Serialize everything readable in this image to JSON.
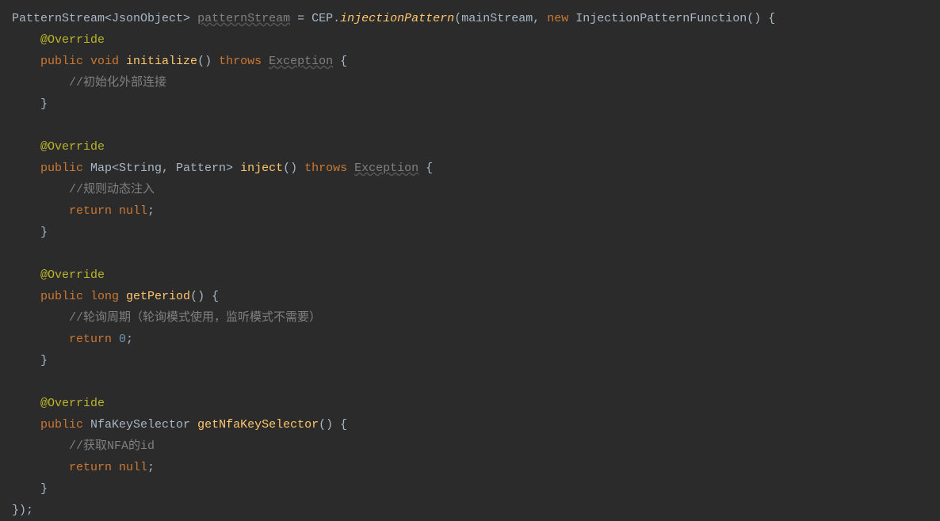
{
  "code": {
    "line1": {
      "type1": "PatternStream",
      "generic1": "<JsonObject>",
      "varName": "patternStream",
      "equals": " = ",
      "cls": "CEP",
      "dot": ".",
      "method": "injectionPattern",
      "args1": "(mainStream, ",
      "newKw": "new",
      "ctor": " InjectionPatternFunction() {"
    },
    "override1": "@Override",
    "line2": {
      "mods": "public void ",
      "method": "initialize",
      "parens": "() ",
      "throwsKw": "throws",
      "sp": " ",
      "exc": "Exception",
      "brace": " {"
    },
    "comment1": "//初始化外部连接",
    "closeBrace1": "}",
    "override2": "@Override",
    "line3": {
      "pub": "public ",
      "ret": "Map<String, Pattern> ",
      "method": "inject",
      "parens": "() ",
      "throwsKw": "throws",
      "sp": " ",
      "exc": "Exception",
      "brace": " {"
    },
    "comment2": "//规则动态注入",
    "return1": {
      "kw": "return ",
      "val": "null",
      "semi": ";"
    },
    "closeBrace2": "}",
    "override3": "@Override",
    "line4": {
      "pub": "public ",
      "ret": "long ",
      "method": "getPeriod",
      "parens": "() {"
    },
    "comment3": "//轮询周期（轮询模式使用，监听模式不需要）",
    "return2": {
      "kw": "return ",
      "val": "0",
      "semi": ";"
    },
    "closeBrace3": "}",
    "override4": "@Override",
    "line5": {
      "pub": "public ",
      "ret": "NfaKeySelector ",
      "method": "getNfaKeySelector",
      "parens": "() {"
    },
    "comment4": "//获取NFA的id",
    "return3": {
      "kw": "return ",
      "val": "null",
      "semi": ";"
    },
    "closeBrace4": "}",
    "finalClose": "});"
  }
}
